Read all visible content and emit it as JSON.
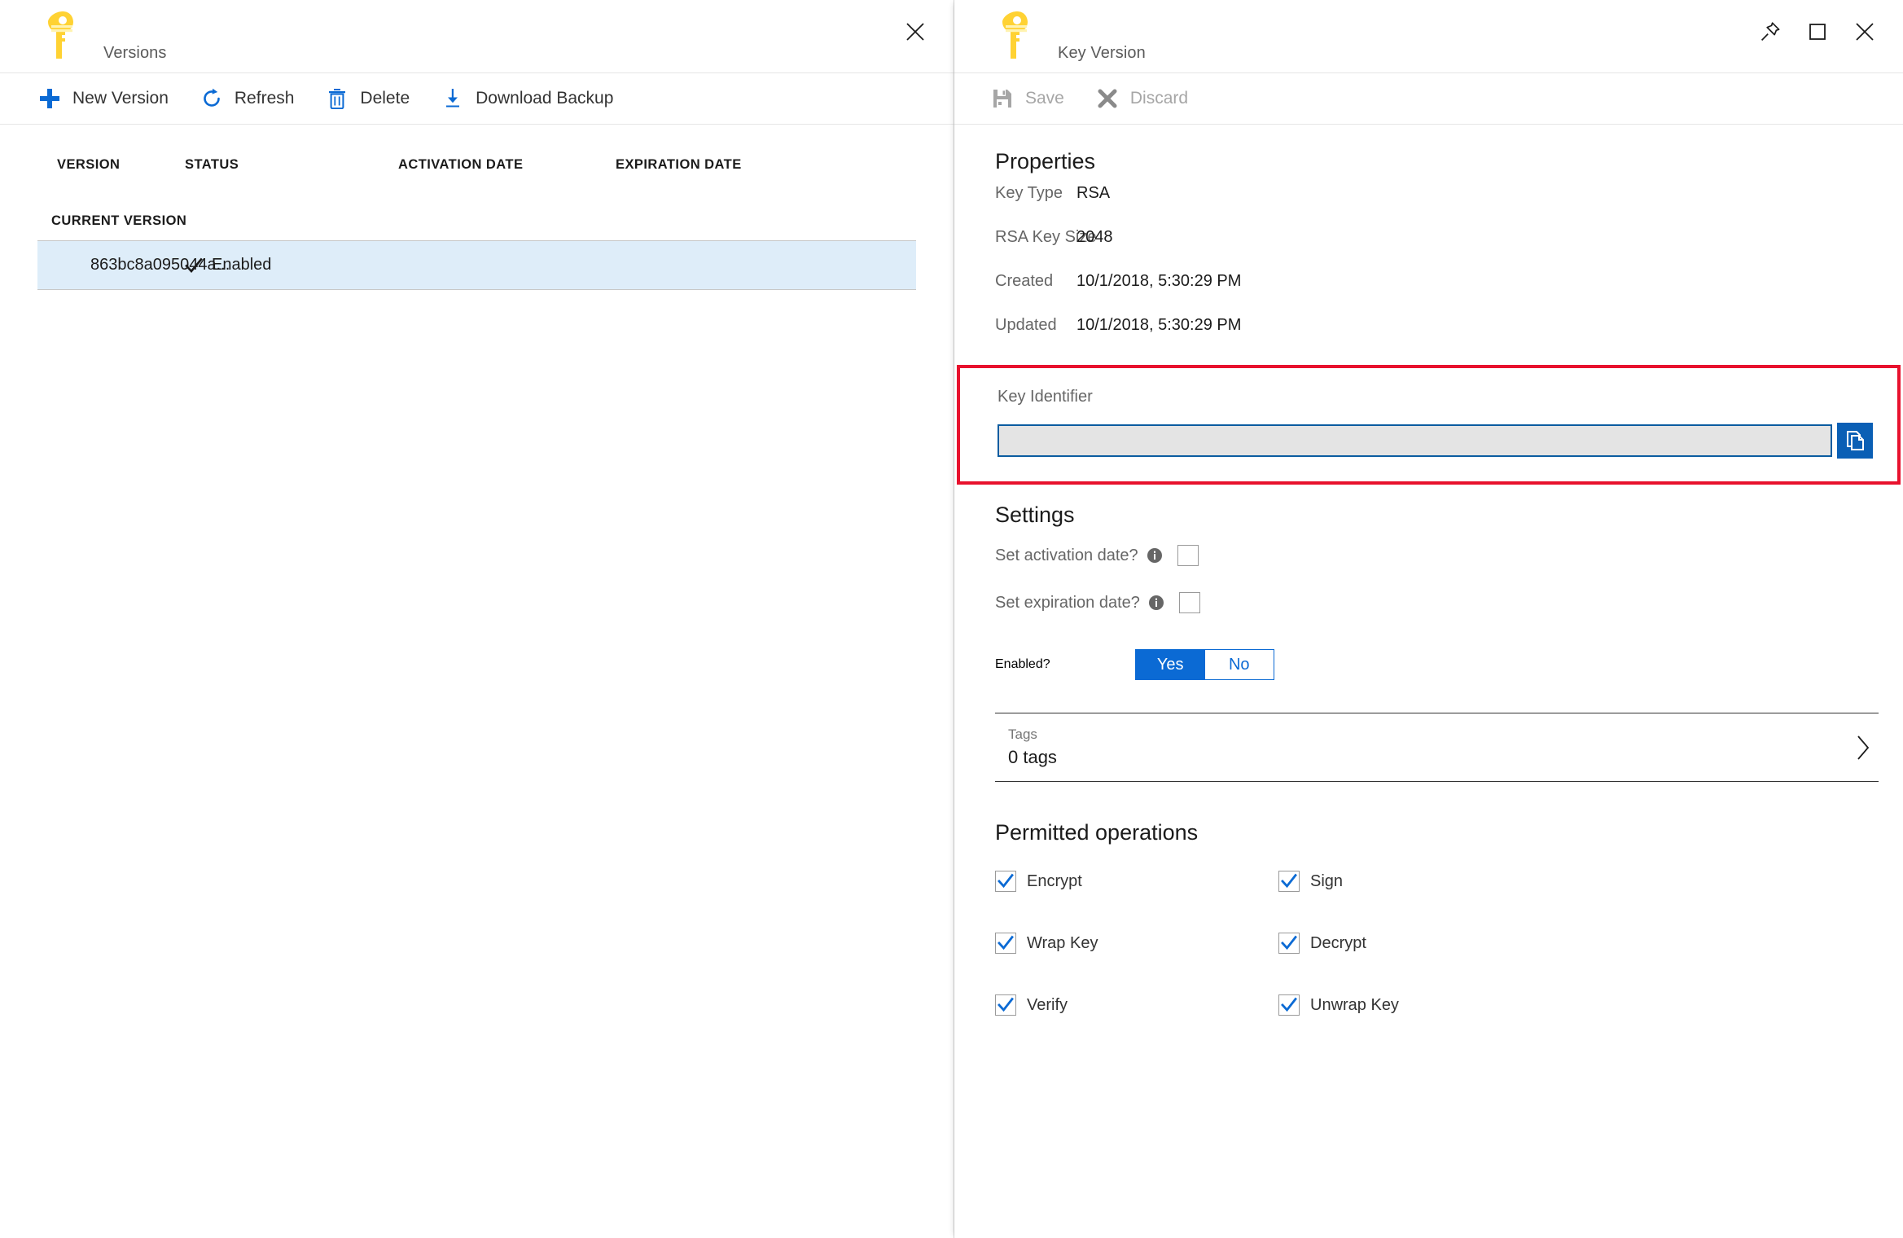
{
  "colors": {
    "accent_blue": "#0b6ad4",
    "link_blue": "#0a5fb5",
    "highlight_red": "#e8112d",
    "key_yellow": "#ffd233",
    "row_selected": "#deedf9",
    "text_primary": "#1b1b1b",
    "text_secondary": "#666666",
    "disabled_gray": "#a6a6a6"
  },
  "left_blade": {
    "icon": "key-icon",
    "title": "Versions",
    "close_icon": "close-icon",
    "toolbar": [
      {
        "label": "New Version",
        "icon": "plus-icon",
        "disabled": false
      },
      {
        "label": "Refresh",
        "icon": "refresh-icon",
        "disabled": false
      },
      {
        "label": "Delete",
        "icon": "trash-icon",
        "disabled": false
      },
      {
        "label": "Download Backup",
        "icon": "download-icon",
        "disabled": false
      }
    ],
    "table": {
      "columns": [
        "VERSION",
        "STATUS",
        "ACTIVATION DATE",
        "EXPIRATION DATE"
      ],
      "group_label": "CURRENT VERSION",
      "rows": [
        {
          "version": "863bc8a095044a...",
          "status": "Enabled",
          "status_icon": "checkmark-icon",
          "activation_date": "",
          "expiration_date": "",
          "selected": true
        }
      ]
    }
  },
  "right_blade": {
    "icon": "key-icon",
    "title": "Key Version",
    "window_controls": [
      {
        "name": "pin-icon"
      },
      {
        "name": "maximize-icon"
      },
      {
        "name": "close-icon"
      }
    ],
    "toolbar": [
      {
        "label": "Save",
        "icon": "save-icon",
        "disabled": true
      },
      {
        "label": "Discard",
        "icon": "discard-icon",
        "disabled": true
      }
    ],
    "properties": {
      "heading": "Properties",
      "items": [
        {
          "key": "Key Type",
          "value": "RSA"
        },
        {
          "key": "RSA Key Size",
          "value": "2048"
        },
        {
          "key": "Created",
          "value": "10/1/2018, 5:30:29 PM"
        },
        {
          "key": "Updated",
          "value": "10/1/2018, 5:30:29 PM"
        }
      ]
    },
    "key_identifier": {
      "label": "Key Identifier",
      "value": "",
      "copy_icon": "copy-icon",
      "highlighted": true
    },
    "settings": {
      "heading": "Settings",
      "activation": {
        "label": "Set activation date?",
        "info_icon": "info-icon",
        "checked": false
      },
      "expiration": {
        "label": "Set expiration date?",
        "info_icon": "info-icon",
        "checked": false
      },
      "enabled": {
        "label": "Enabled?",
        "yes": "Yes",
        "no": "No",
        "selected": "Yes"
      }
    },
    "tags": {
      "label": "Tags",
      "value": "0 tags",
      "chevron_icon": "chevron-right-icon"
    },
    "permitted_operations": {
      "heading": "Permitted operations",
      "items": [
        {
          "label": "Encrypt",
          "checked": true
        },
        {
          "label": "Sign",
          "checked": true
        },
        {
          "label": "Wrap Key",
          "checked": true
        },
        {
          "label": "Decrypt",
          "checked": true
        },
        {
          "label": "Verify",
          "checked": true
        },
        {
          "label": "Unwrap Key",
          "checked": true
        }
      ]
    }
  }
}
